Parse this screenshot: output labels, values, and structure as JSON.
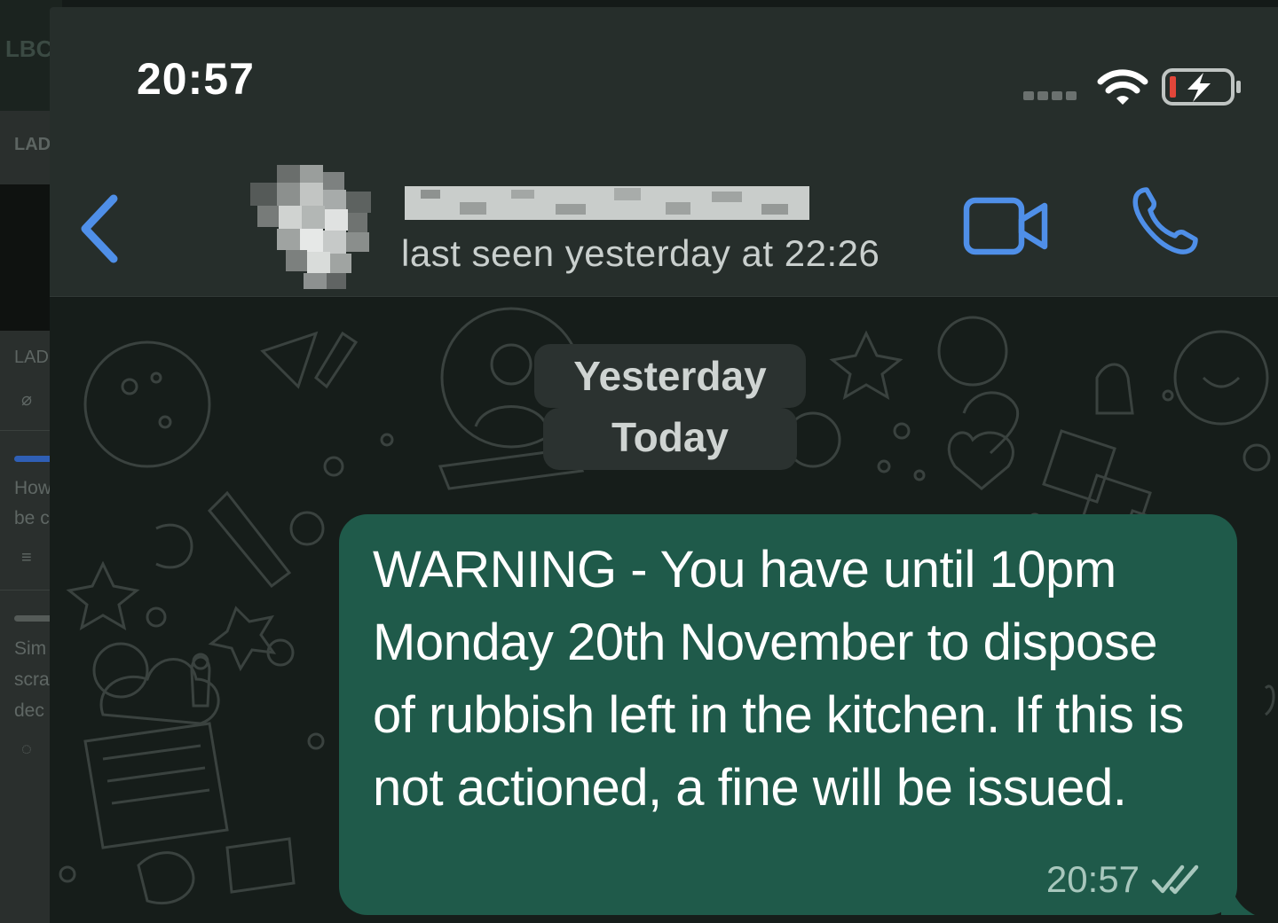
{
  "background_page": {
    "logo": "LBC",
    "section_1": "LAD",
    "section_2": "LAD",
    "article_1_lines": [
      "How",
      "be c"
    ],
    "article_2_lines": [
      "Sim",
      "scra",
      "dec"
    ]
  },
  "status_bar": {
    "time": "20:57"
  },
  "chat_header": {
    "last_seen": "last seen yesterday at 22:26"
  },
  "chat": {
    "date_separators": [
      "Yesterday",
      "Today"
    ],
    "message": {
      "text": "WARNING - You have until 10pm Monday 20th November to dispose of rubbish left in the kitchen. If this is not actioned, a fine will be issued.",
      "time": "20:57",
      "status_icon": "double-check-icon"
    }
  },
  "colors": {
    "header_bg": "#262e2b",
    "chat_bg": "#161d1a",
    "bubble_bg": "#1f5a4a",
    "accent_blue": "#4f8fe8",
    "battery_red": "#e2463a"
  }
}
